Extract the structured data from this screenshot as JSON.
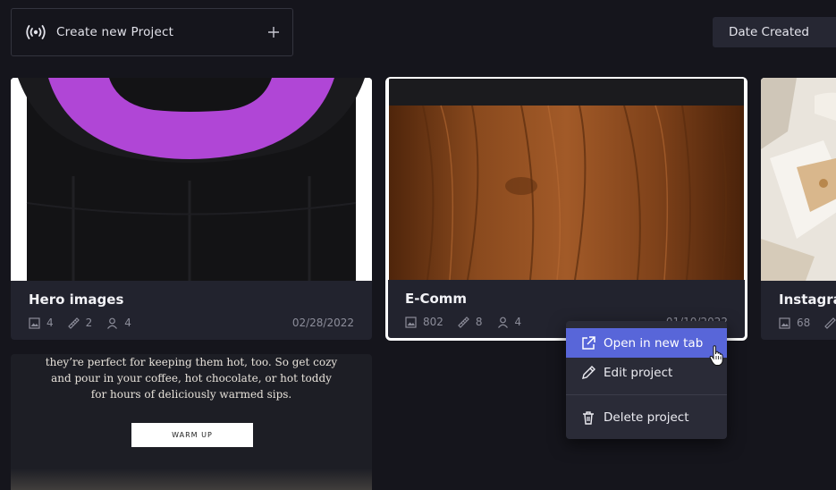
{
  "header": {
    "create_label": "Create new Project",
    "sort_label": "Date Created"
  },
  "projects": [
    {
      "title": "Hero images",
      "images": "4",
      "annotations": "2",
      "members": "4",
      "date": "02/28/2022"
    },
    {
      "title": "E-Comm",
      "images": "802",
      "annotations": "8",
      "members": "4",
      "date": "01/10/2022"
    },
    {
      "title": "Instagram",
      "images": "68",
      "annotations": "",
      "members": "",
      "date": ""
    }
  ],
  "promo": {
    "lines": [
      "they’re perfect for keeping them hot, too. So get cozy",
      "and pour in your coffee, hot chocolate, or hot toddy",
      "for hours of deliciously warmed sips."
    ],
    "button_label": "WARM UP"
  },
  "context_menu": {
    "items": [
      {
        "label": "Open in new tab"
      },
      {
        "label": "Edit project"
      },
      {
        "label": "Delete project"
      }
    ]
  },
  "colors": {
    "background": "#15151c",
    "card": "#22232e",
    "menu_active": "#5866d9",
    "bottle_purple": "#b046d6",
    "wood": "#8a4a1e"
  }
}
